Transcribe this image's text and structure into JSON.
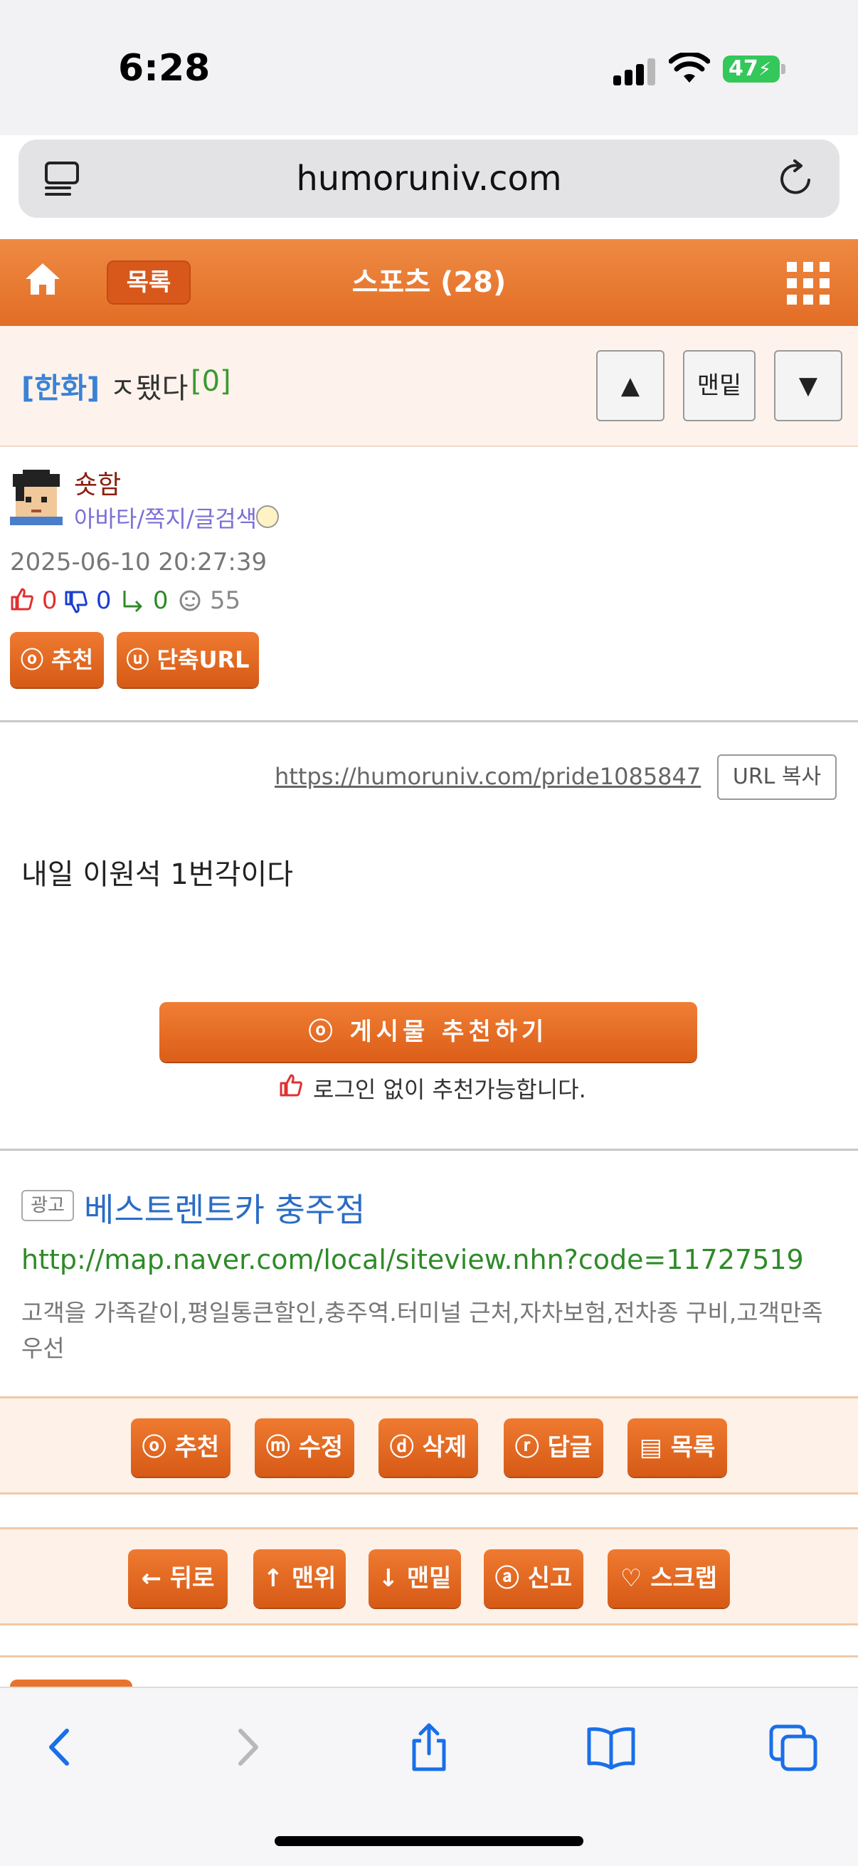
{
  "status": {
    "time": "6:28",
    "battery": "47"
  },
  "browser": {
    "url": "humoruniv.com"
  },
  "header": {
    "list_label": "목록",
    "title": "스포츠 (28)"
  },
  "post": {
    "category": "[한화]",
    "title": "ㅈ됐다",
    "comment_count": "[0]",
    "nav": {
      "up": "▲",
      "bottom": "맨밑",
      "down": "▼"
    },
    "author": {
      "name": "숏함",
      "links": "아바타/쪽지/글검색"
    },
    "date": "2025-06-10 20:27:39",
    "stats": {
      "likes": "0",
      "dislikes": "0",
      "replies": "0",
      "views": "55"
    },
    "buttons": {
      "recommend": "ⓞ 추천",
      "short_url": "ⓤ 단축URL"
    },
    "permalink": "https://humoruniv.com/pride1085847",
    "copy_label": "URL 복사",
    "body": "내일 이원석 1번각이다",
    "recommend_big": "ⓞ 게시물  추천하기",
    "recommend_note": "로그인 없이 추천가능합니다."
  },
  "ad": {
    "badge": "광고",
    "title": "베스트렌트카 충주점",
    "url": "http://map.naver.com/local/siteview.nhn?code=11727519",
    "description": "고객을 가족같이,평일통큰할인,충주역.터미널 근처,자차보험,전차종 구비,고객만족우선"
  },
  "action_bar": [
    {
      "label": "ⓞ 추천"
    },
    {
      "label": "ⓜ 수정"
    },
    {
      "label": "ⓓ 삭제"
    },
    {
      "label": "ⓡ 답글"
    },
    {
      "label": "▤ 목록"
    }
  ],
  "nav_bar": [
    {
      "label": "← 뒤로"
    },
    {
      "label": "↑ 맨위"
    },
    {
      "label": "↓ 맨밑"
    },
    {
      "label": "ⓐ 신고"
    },
    {
      "label": "♡ 스크랩"
    }
  ],
  "colors": {
    "accent": "#e8732c",
    "category": "#3a82d6",
    "ad_title": "#2b6cc6",
    "ad_url": "#2f8a28"
  },
  "icons": [
    "home-icon",
    "grid-icon",
    "reader-icon",
    "reload-icon",
    "thumb-up-icon",
    "thumb-down-icon",
    "reply-icon",
    "views-icon",
    "back-icon",
    "forward-icon",
    "share-icon",
    "bookmarks-icon",
    "tabs-icon"
  ]
}
